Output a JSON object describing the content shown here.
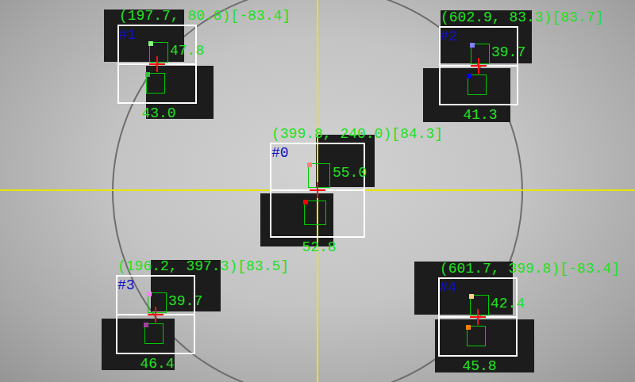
{
  "markers": [
    {
      "id": "#0",
      "position": "(399.8, 240.0)",
      "angle": "[84.3]",
      "upper": {
        "value": "55.0",
        "color": "#ff8080"
      },
      "lower": {
        "value": "52.8",
        "color": "#ff0000"
      }
    },
    {
      "id": "#1",
      "position": "(197.7, 80.8)",
      "angle": "[-83.4]",
      "upper": {
        "value": "47.8",
        "color": "#80ff80"
      },
      "lower": {
        "value": "43.0",
        "color": "#40c040"
      }
    },
    {
      "id": "#2",
      "position": "(602.9, 83.3)",
      "angle": "[83.7]",
      "upper": {
        "value": "39.7",
        "color": "#8080ff"
      },
      "lower": {
        "value": "41.3",
        "color": "#0000ff"
      }
    },
    {
      "id": "#3",
      "position": "(196.2, 397.3)",
      "angle": "[83.5]",
      "upper": {
        "value": "39.7",
        "color": "#ff80ff"
      },
      "lower": {
        "value": "46.4",
        "color": "#a040a0"
      }
    },
    {
      "id": "#4",
      "position": "(601.7, 399.8)",
      "angle": "[-83.4]",
      "upper": {
        "value": "42.4",
        "color": "#ffd080"
      },
      "lower": {
        "value": "45.8",
        "color": "#ff8000"
      }
    }
  ]
}
